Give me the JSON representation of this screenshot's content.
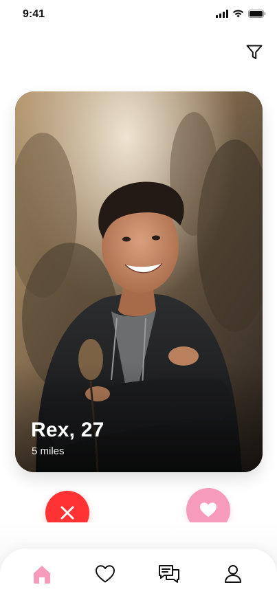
{
  "status_bar": {
    "time": "9:41",
    "icons": [
      "signal-icon",
      "wifi-icon",
      "battery-icon"
    ]
  },
  "header": {
    "filter_icon": "filter-icon"
  },
  "profile_card": {
    "name_age": "Rex, 27",
    "distance": "5 miles"
  },
  "actions": {
    "dislike_icon": "close-icon",
    "like_icon": "heart-icon"
  },
  "colors": {
    "dislike": "#ff3333",
    "like": "#f79bbd",
    "active_tab": "#f79bbd"
  },
  "tab_bar": {
    "tabs": [
      {
        "icon": "home-icon",
        "active": true
      },
      {
        "icon": "heart-outline-icon",
        "active": false
      },
      {
        "icon": "chat-icon",
        "active": false
      },
      {
        "icon": "user-icon",
        "active": false
      }
    ]
  }
}
